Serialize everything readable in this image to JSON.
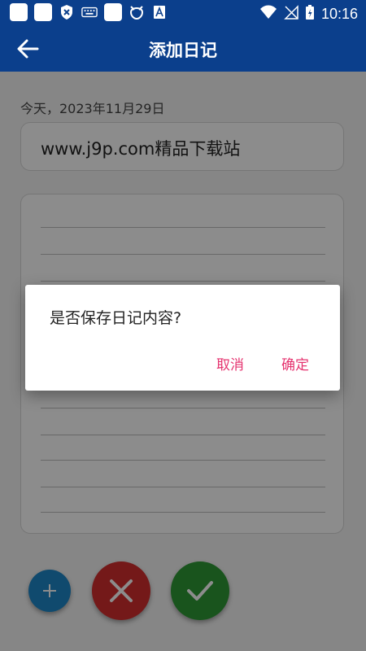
{
  "status_bar": {
    "time": "10:16",
    "left_icons": [
      "app-icon",
      "app-icon",
      "shield-icon",
      "keyboard-icon",
      "app-icon",
      "cat-icon",
      "font-icon"
    ],
    "right_icons": [
      "wifi-icon",
      "no-signal-icon",
      "battery-charging-icon"
    ]
  },
  "app_bar": {
    "title": "添加日记",
    "color": "#0b3f8c"
  },
  "editor": {
    "date_label": "今天，2023年11月29日",
    "title_value": "www.j9p.com精品下载站",
    "body_value": ""
  },
  "fabs": {
    "add_icon": "plus-icon",
    "cancel_icon": "close-icon",
    "confirm_icon": "check-icon",
    "add_color": "#1e88c8",
    "cancel_color": "#d32f2f",
    "confirm_color": "#2e9a35"
  },
  "dialog": {
    "message": "是否保存日记内容?",
    "cancel_label": "取消",
    "confirm_label": "确定",
    "button_color": "#e5336f"
  }
}
